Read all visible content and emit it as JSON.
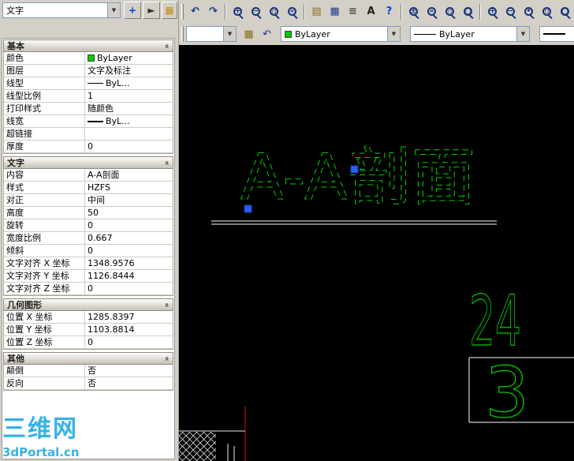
{
  "icons": {
    "dropdown_arrow": "▼",
    "collapse_chevron": "»",
    "pickadd_glyph": "+",
    "select_objects_glyph": "►",
    "quick_select_glyph": "▦"
  },
  "left_panel": {
    "object_type": "文字",
    "sections": [
      {
        "title": "基本",
        "rows": [
          {
            "label": "颜色",
            "value": "ByLayer",
            "swatch": "#00cc00"
          },
          {
            "label": "图层",
            "value": "文字及标注"
          },
          {
            "label": "线型",
            "value": "ByL...",
            "line": "thin"
          },
          {
            "label": "线型比例",
            "value": "1"
          },
          {
            "label": "打印样式",
            "value": "随颜色"
          },
          {
            "label": "线宽",
            "value": "ByL...",
            "line": "thick"
          },
          {
            "label": "超链接",
            "value": ""
          },
          {
            "label": "厚度",
            "value": "0"
          }
        ]
      },
      {
        "title": "文字",
        "rows": [
          {
            "label": "内容",
            "value": "A-A剖面"
          },
          {
            "label": "样式",
            "value": "HZFS"
          },
          {
            "label": "对正",
            "value": "中间"
          },
          {
            "label": "高度",
            "value": "50"
          },
          {
            "label": "旋转",
            "value": "0"
          },
          {
            "label": "宽度比例",
            "value": "0.667"
          },
          {
            "label": "倾斜",
            "value": "0"
          },
          {
            "label": "文字对齐 X 坐标",
            "value": "1348.9576"
          },
          {
            "label": "文字对齐 Y 坐标",
            "value": "1126.8444"
          },
          {
            "label": "文字对齐 Z 坐标",
            "value": "0"
          }
        ]
      },
      {
        "title": "几何图形",
        "rows": [
          {
            "label": "位置 X 坐标",
            "value": "1285.8397"
          },
          {
            "label": "位置 Y 坐标",
            "value": "1103.8814"
          },
          {
            "label": "位置 Z 坐标",
            "value": "0"
          }
        ]
      },
      {
        "title": "其他",
        "rows": [
          {
            "label": "颠倒",
            "value": "否"
          },
          {
            "label": "反向",
            "value": "否"
          }
        ]
      }
    ]
  },
  "toolbar_top": {
    "buttons": [
      {
        "type": "grip"
      },
      {
        "type": "glyph",
        "name": "undo-button",
        "glyph": "↶",
        "color": "#1a3a8c"
      },
      {
        "type": "glyph",
        "name": "redo-button",
        "glyph": "↷",
        "color": "#1a3a8c"
      },
      {
        "type": "sep"
      },
      {
        "type": "mag",
        "name": "zoom-in-button",
        "sign": "+"
      },
      {
        "type": "mag",
        "name": "zoom-out-button",
        "sign": "−"
      },
      {
        "type": "mag",
        "name": "zoom-window-button",
        "sign": "▫"
      },
      {
        "type": "mag",
        "name": "zoom-previous-button",
        "sign": "«"
      },
      {
        "type": "sep"
      },
      {
        "type": "glyph",
        "name": "named-views-button",
        "glyph": "▤",
        "color": "#8a6d1a"
      },
      {
        "type": "glyph",
        "name": "layer-manager-button",
        "glyph": "▦",
        "color": "#1a3a8c"
      },
      {
        "type": "glyph",
        "name": "linetype-manager-button",
        "glyph": "≡",
        "color": "#444444"
      },
      {
        "type": "glyph",
        "name": "text-style-button",
        "glyph": "A",
        "color": "#222222"
      },
      {
        "type": "glyph",
        "name": "help-button",
        "glyph": "?",
        "color": "#0046d5"
      },
      {
        "type": "sep"
      },
      {
        "type": "mag",
        "name": "zoom-realtime-button",
        "sign": "±"
      },
      {
        "type": "mag",
        "name": "zoom-previous-2-button",
        "sign": "«"
      },
      {
        "type": "mag",
        "name": "zoom-window-2-button",
        "sign": "▫"
      },
      {
        "type": "mag",
        "name": "zoom-extents-button",
        "sign": "○"
      },
      {
        "type": "sep"
      },
      {
        "type": "mag",
        "name": "zoom-in-2-button",
        "sign": "+"
      },
      {
        "type": "mag",
        "name": "zoom-out-2-button",
        "sign": "−"
      },
      {
        "type": "mag",
        "name": "zoom-center-button",
        "sign": "•"
      },
      {
        "type": "mag",
        "name": "zoom-scale-button",
        "sign": "▫"
      },
      {
        "type": "mag",
        "name": "zoom-all-button",
        "sign": "○"
      }
    ]
  },
  "toolbar_properties": {
    "layer_value": "",
    "color_control": {
      "value": "ByLayer",
      "swatch": "#00cc00"
    },
    "linetype_control": {
      "value": "ByLayer"
    },
    "lineweight_control": {
      "value": ""
    }
  },
  "canvas": {
    "text_label": "A-A剖面",
    "dim_value_1": "24",
    "dim_value_2": "3",
    "entity_color": "#00cc00",
    "grip_color": "#2e5bff"
  },
  "watermark": {
    "title": "三维网",
    "site": "3dPortal.cn"
  }
}
